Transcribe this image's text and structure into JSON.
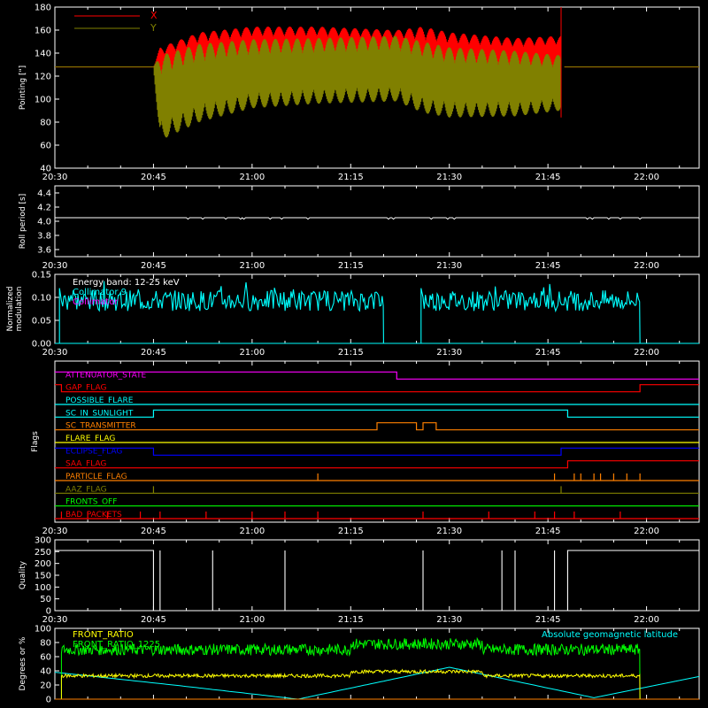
{
  "colors": {
    "background": "#000000",
    "axes": "#ffffff",
    "x_series": "#ff0000",
    "y_series": "#808000",
    "cyan": "#00ffff",
    "magenta": "#ff00ff",
    "yellow": "#ffff00",
    "green": "#00ff00",
    "blue": "#0000ff",
    "orange": "#ff8000",
    "red": "#ff0000"
  },
  "chart_data": [
    {
      "type": "line",
      "panel": "pointing",
      "xlabel": "",
      "ylabel": "Pointing [\"]",
      "xlim": [
        "20:30",
        "22:08"
      ],
      "ylim": [
        40,
        180
      ],
      "yticks": [
        "40",
        "60",
        "80",
        "100",
        "120",
        "140",
        "160",
        "180"
      ],
      "xticks": [
        "20:30",
        "20:45",
        "21:00",
        "21:15",
        "21:30",
        "21:45",
        "22:00"
      ],
      "legend": [
        "X",
        "Y"
      ],
      "legend_position": "top-left",
      "series": [
        {
          "name": "X",
          "color": "x_series",
          "x": [
            "20:30",
            "20:45",
            "20:46",
            "20:52",
            "21:00",
            "21:10",
            "21:22",
            "21:26",
            "21:30",
            "21:40",
            "21:47",
            "21:48",
            "22:08"
          ],
          "upper": [
            128,
            128,
            145,
            158,
            163,
            163,
            160,
            163,
            158,
            153,
            155,
            128,
            128
          ],
          "lower": [
            128,
            128,
            110,
            118,
            124,
            126,
            127,
            112,
            115,
            118,
            120,
            128,
            128
          ]
        },
        {
          "name": "Y",
          "color": "y_series",
          "x": [
            "20:30",
            "20:45",
            "20:46",
            "20:52",
            "21:00",
            "21:10",
            "21:22",
            "21:26",
            "21:30",
            "21:40",
            "21:47",
            "21:48",
            "22:08"
          ],
          "upper": [
            128,
            128,
            138,
            148,
            152,
            153,
            155,
            150,
            145,
            142,
            138,
            128,
            128
          ],
          "lower": [
            128,
            128,
            64,
            80,
            92,
            96,
            98,
            88,
            84,
            85,
            90,
            128,
            128
          ]
        }
      ]
    },
    {
      "type": "line",
      "panel": "roll",
      "ylabel": "Roll period [s]",
      "ylim": [
        3.5,
        4.5
      ],
      "yticks": [
        "3.6",
        "3.8",
        "4.0",
        "4.2",
        "4.4"
      ],
      "xticks": [
        "20:30",
        "20:45",
        "21:00",
        "21:15",
        "21:30",
        "21:45",
        "22:00"
      ],
      "series": [
        {
          "name": "",
          "color": "axes",
          "x": [
            "20:30",
            "22:08"
          ],
          "y": [
            4.05,
            4.05
          ]
        }
      ]
    },
    {
      "type": "line",
      "panel": "modulation",
      "ylabel": "Normalized modulation",
      "ylim": [
        0,
        0.15
      ],
      "yticks": [
        "0.00",
        "0.05",
        "0.10",
        "0.15"
      ],
      "xticks": [
        "20:30",
        "20:45",
        "21:00",
        "21:15",
        "21:30",
        "21:45",
        "22:00"
      ],
      "annotations": [
        "Energy band: 12-25 keV",
        "Collimator 9",
        "Collimator"
      ],
      "segments": [
        {
          "x": [
            "20:31",
            "21:20"
          ],
          "mean": 0.093,
          "color": "cyan"
        },
        {
          "x": [
            "21:26",
            "21:59"
          ],
          "mean": 0.093,
          "color": "cyan"
        }
      ]
    },
    {
      "type": "line",
      "panel": "flags",
      "ylabel": "Flags",
      "xticks": [
        "20:30",
        "20:45",
        "21:00",
        "21:15",
        "21:30",
        "21:45",
        "22:00"
      ],
      "flags": [
        {
          "name": "ATTENUATOR_STATE",
          "color": "magenta",
          "steps": [
            [
              "20:30",
              1
            ],
            [
              "21:22",
              0
            ]
          ]
        },
        {
          "name": "GAP_FLAG",
          "color": "red",
          "steps": [
            [
              "20:30",
              1
            ],
            [
              "20:31",
              0
            ],
            [
              "21:59",
              1
            ]
          ]
        },
        {
          "name": "POSSIBLE_FLARE",
          "color": "cyan",
          "steps": [
            [
              "20:30",
              0
            ]
          ]
        },
        {
          "name": "SC_IN_SUNLIGHT",
          "color": "cyan",
          "steps": [
            [
              "20:30",
              0
            ],
            [
              "20:45",
              1
            ],
            [
              "21:48",
              0
            ]
          ]
        },
        {
          "name": "SC_TRANSMITTER",
          "color": "orange",
          "steps": [
            [
              "20:30",
              0
            ],
            [
              "21:19",
              1
            ],
            [
              "21:25",
              0
            ],
            [
              "21:26",
              1
            ],
            [
              "21:28",
              0
            ]
          ]
        },
        {
          "name": "FLARE_FLAG",
          "color": "yellow",
          "steps": [
            [
              "20:30",
              0
            ]
          ]
        },
        {
          "name": "ECLIPSE_FLAG",
          "color": "blue",
          "steps": [
            [
              "20:30",
              1
            ],
            [
              "20:45",
              0
            ],
            [
              "21:47",
              1
            ]
          ]
        },
        {
          "name": "SAA_FLAG",
          "color": "red",
          "steps": [
            [
              "20:30",
              0
            ],
            [
              "21:48",
              1
            ]
          ]
        },
        {
          "name": "PARTICLE_FLAG",
          "color": "orange",
          "spikes": [
            "21:10",
            "21:46",
            "21:49",
            "21:50",
            "21:52",
            "21:53",
            "21:55",
            "21:57",
            "21:59"
          ]
        },
        {
          "name": "AAZ_FLAG",
          "color": "y_series",
          "spikes": [
            "20:45",
            "21:47"
          ]
        },
        {
          "name": "FRONTS_OFF",
          "color": "green",
          "steps": [
            [
              "20:30",
              0
            ]
          ]
        },
        {
          "name": "BAD_PACKETS",
          "color": "red",
          "spikes": [
            "20:31",
            "20:35",
            "20:38",
            "20:43",
            "20:46",
            "20:53",
            "21:00",
            "21:05",
            "21:10",
            "21:26",
            "21:36",
            "21:43",
            "21:46",
            "21:49",
            "21:56"
          ]
        }
      ]
    },
    {
      "type": "line",
      "panel": "quality",
      "ylabel": "Quality",
      "ylim": [
        0,
        300
      ],
      "yticks": [
        "0",
        "50",
        "100",
        "150",
        "200",
        "250",
        "300"
      ],
      "xticks": [
        "20:30",
        "20:45",
        "21:00",
        "21:15",
        "21:30",
        "21:45",
        "22:00"
      ],
      "series": [
        {
          "name": "",
          "color": "axes",
          "steps": [
            [
              "20:30",
              255
            ],
            [
              "20:45",
              0
            ],
            [
              "21:48",
              255
            ]
          ],
          "spikes": [
            "20:46",
            "20:54",
            "21:05",
            "21:26",
            "21:38",
            "21:40",
            "21:46"
          ]
        }
      ]
    },
    {
      "type": "line",
      "panel": "ratios",
      "ylabel": "Degrees or %",
      "ylim": [
        0,
        100
      ],
      "yticks": [
        "0",
        "20",
        "40",
        "60",
        "80",
        "100"
      ],
      "xticks": [
        "20:30",
        "20:45",
        "21:00",
        "21:15",
        "21:30",
        "21:45",
        "22:00"
      ],
      "annotations": [
        "FRONT_RATIO",
        "FRONT_RATIO_1225",
        "Absolute geomagnetic latitude"
      ],
      "series": [
        {
          "name": "FRONT_RATIO",
          "color": "green",
          "x": [
            "20:31",
            "21:59"
          ],
          "mean": 70
        },
        {
          "name": "FRONT_RATIO_1225",
          "color": "yellow",
          "x": [
            "20:31",
            "21:59"
          ],
          "mean": 33
        },
        {
          "name": "Absolute geomagnetic latitude",
          "color": "cyan",
          "x": [
            "20:30",
            "20:48",
            "21:07",
            "21:30",
            "21:52",
            "22:08"
          ],
          "y": [
            38,
            20,
            0,
            45,
            2,
            32
          ]
        }
      ]
    }
  ]
}
